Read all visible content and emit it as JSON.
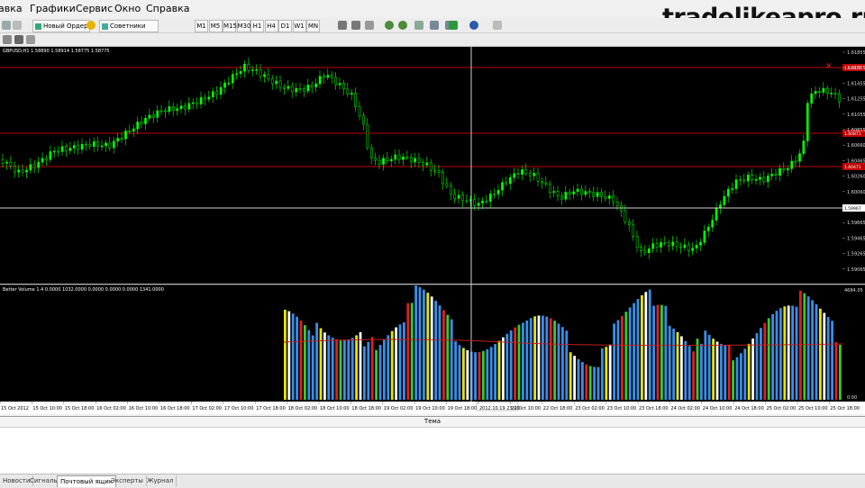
{
  "menu": [
    "авка",
    "Графики",
    "Сервис",
    "Окно",
    "Справка"
  ],
  "watermark": "tradelikeapro.ru",
  "toolbar": {
    "new_order": "Новый Ордер",
    "advisors": "Советники",
    "timeframes": [
      "M1",
      "M5",
      "M15",
      "M30",
      "H1",
      "H4",
      "D1",
      "W1",
      "MN"
    ]
  },
  "chart": {
    "main_title": "GBPUSD,H1  1.58890 1.58914 1.58775 1.58775",
    "indicator_title": "Better Volume 1.4 0.0000 1032.0000 0.0000 0.0000 0.0000 1341.0000",
    "price_levels": [
      "1.61855",
      "1.61655",
      "1.61455",
      "1.61255",
      "1.61055",
      "1.60855",
      "1.60660",
      "1.60465",
      "1.60260",
      "1.60060",
      "1.59860",
      "1.59665",
      "1.59465",
      "1.59265",
      "1.59065"
    ],
    "hline_labels": [
      "1.61671",
      "1.60871",
      "1.60471"
    ],
    "crosshair_price": "1.59967",
    "volume_max": "4684.05",
    "volume_min": "0.00",
    "time_labels": [
      "15 Oct 2012",
      "15 Oct 10:00",
      "15 Oct 18:00",
      "16 Oct 02:00",
      "16 Oct 10:00",
      "16 Oct 18:00",
      "17 Oct 02:00",
      "17 Oct 10:00",
      "17 Oct 18:00",
      "18 Oct 02:00",
      "18 Oct 10:00",
      "18 Oct 18:00",
      "19 Oct 02:00",
      "19 Oct 10:00",
      "19 Oct 18:00",
      "2012.10.19 23:00",
      "22 Oct 10:00",
      "22 Oct 18:00",
      "23 Oct 02:00",
      "23 Oct 10:00",
      "23 Oct 18:00",
      "24 Oct 02:00",
      "24 Oct 10:00",
      "24 Oct 18:00",
      "25 Oct 02:00",
      "25 Oct 10:00",
      "25 Oct 18:00"
    ]
  },
  "terminal": {
    "column_header": "Тема",
    "tabs": [
      "Новости",
      "Сигналы",
      "Почтовый ящик",
      "Эксперты",
      "Журнал"
    ],
    "active_tab": "Почтовый ящик"
  },
  "colors": {
    "bullish": "#00ff00",
    "volume_blue": "#3a8ee6",
    "volume_red": "#e02020",
    "volume_white": "#ffffff",
    "volume_green": "#33cc33",
    "volume_yellow": "#e6e600",
    "level_line": "#c00000"
  }
}
